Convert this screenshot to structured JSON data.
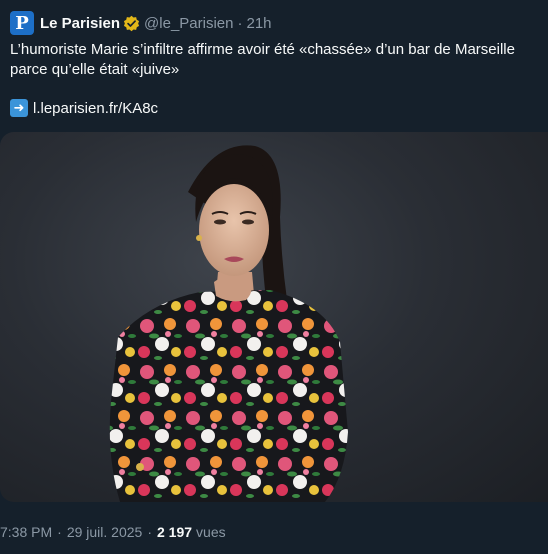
{
  "tweet": {
    "author": {
      "avatar_letter": "P",
      "name": "Le Parisien",
      "handle": "@le_Parisien",
      "verified_badge": "gold-verified-badge-icon"
    },
    "age": "21h",
    "text": "L’humoriste Marie s’infiltre affirme avoir été «chassée» d’un bar de Marseille parce qu’elle était «juive»",
    "link_icon": "right-arrow-icon",
    "link": "l.leparisien.fr/KA8c",
    "media": {
      "type": "photo"
    },
    "meta": {
      "time": "7:38 PM",
      "date": "29 juil. 2025",
      "views_count": "2 197",
      "views_label": "vues"
    }
  },
  "colors": {
    "background": "#15202b",
    "text": "#f7f9f9",
    "secondary": "#8b98a5",
    "avatar": "#1d6fc7",
    "badge": "#e2b719"
  }
}
